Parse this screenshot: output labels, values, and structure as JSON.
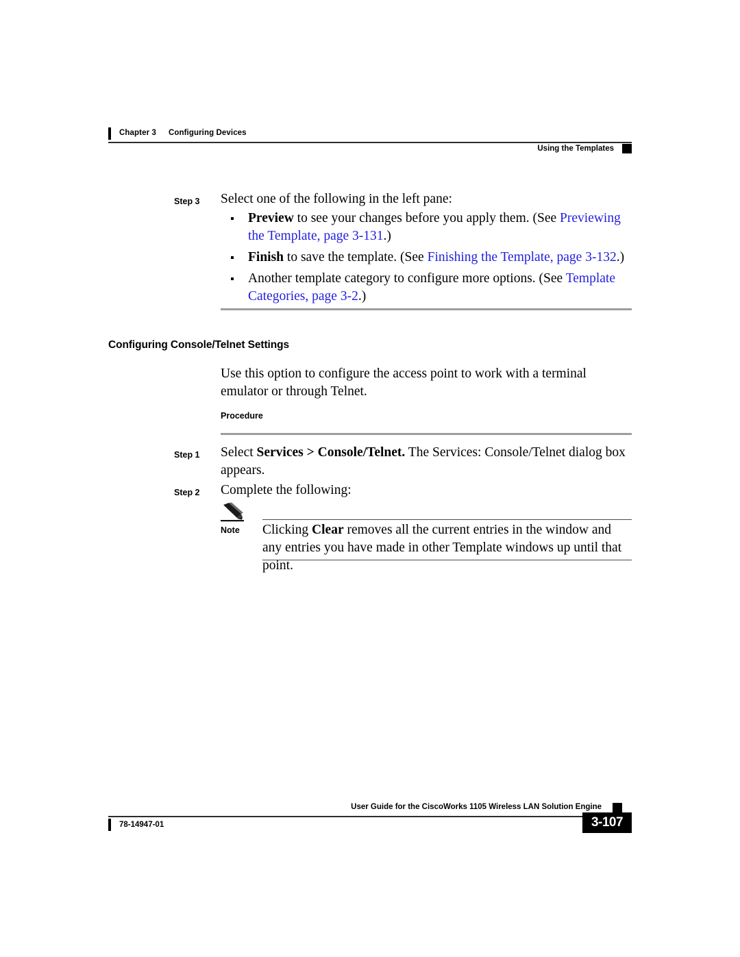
{
  "header": {
    "chapter_number": "Chapter 3",
    "chapter_title": "Configuring Devices",
    "running_head": "Using the Templates"
  },
  "content": {
    "step3": {
      "label": "Step 3",
      "text": "Select one of the following in the left pane:"
    },
    "bullets": [
      {
        "bold_lead": "Preview",
        "text_before_link": " to see your changes before you apply them. (See ",
        "link": "Previewing the Template, page 3-131",
        "text_after_link": ".)"
      },
      {
        "bold_lead": "Finish",
        "text_before_link": " to save the template. (See ",
        "link": "Finishing the Template, page 3-132",
        "text_after_link": ".)"
      },
      {
        "bold_lead": "",
        "text_before_link": "Another template category to configure more options. (See ",
        "link": "Template Categories, page 3-2",
        "text_after_link": ".)"
      }
    ],
    "section_heading": "Configuring Console/Telnet Settings",
    "intro_paragraph": "Use this option to configure the access point to work with a terminal emulator or through Telnet.",
    "procedure_label": "Procedure",
    "step1": {
      "label": "Step 1",
      "text_lead": "Select ",
      "bold_menu": "Services > Console/Telnet.",
      "text_tail": " The Services: Console/Telnet dialog box appears."
    },
    "step2": {
      "label": "Step 2",
      "text": "Complete the following:"
    },
    "note": {
      "label": "Note",
      "icon": "pencil-icon",
      "text_lead": "Clicking ",
      "bold_word": "Clear",
      "text_tail": " removes all the current entries in the window and any entries you have made in other Template windows up until that point."
    }
  },
  "footer": {
    "doc_number": "78-14947-01",
    "book_title": "User Guide for the CiscoWorks 1105 Wireless LAN Solution Engine",
    "page_number": "3-107"
  },
  "colors": {
    "link": "#2420dd",
    "rule_grey": "#9d9d9d",
    "ink": "#000000"
  }
}
